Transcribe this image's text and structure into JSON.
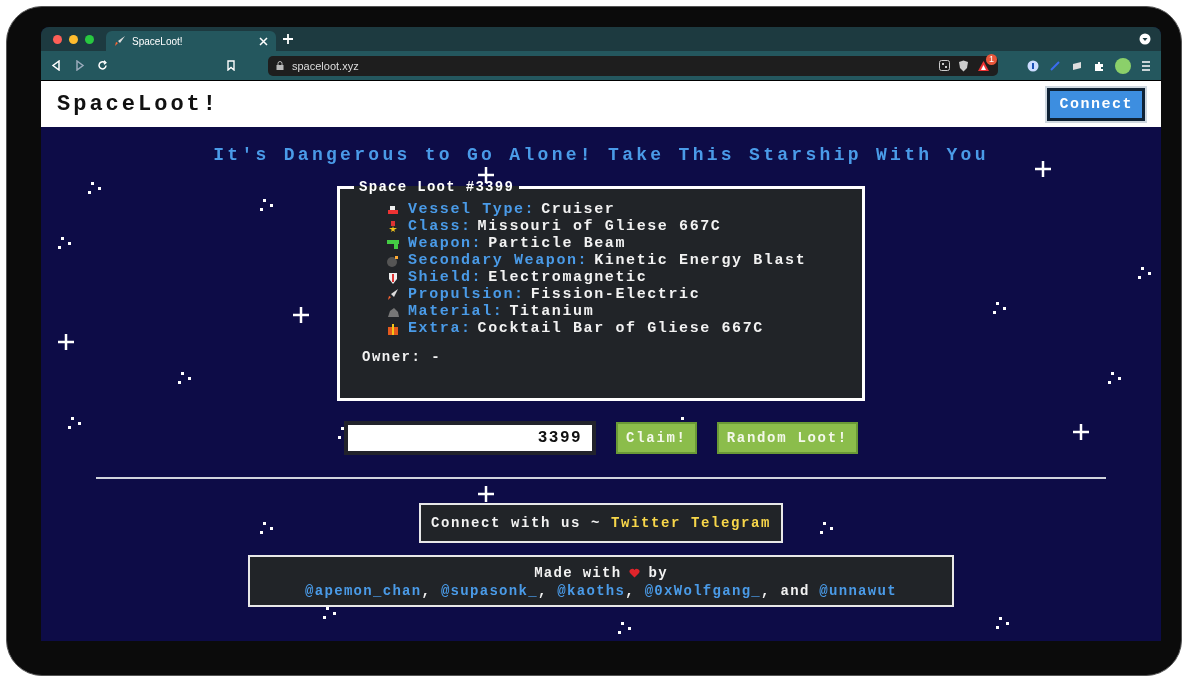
{
  "browser": {
    "tab_title": "SpaceLoot!",
    "url": "spaceloot.xyz",
    "alert_badge": "1"
  },
  "header": {
    "title": "SpaceLoot!",
    "connect_button": "Connect"
  },
  "headline": "It's Dangerous to Go Alone! Take This Starship With You",
  "loot_card": {
    "title": "Space Loot #3399",
    "traits": [
      {
        "kind": "ship",
        "label": "Vessel Type:",
        "value": "Cruiser"
      },
      {
        "kind": "medal",
        "label": "Class:",
        "value": "Missouri of Gliese 667C"
      },
      {
        "kind": "gun",
        "label": "Weapon:",
        "value": "Particle Beam"
      },
      {
        "kind": "bomb",
        "label": "Secondary Weapon:",
        "value": "Kinetic Energy Blast"
      },
      {
        "kind": "shield",
        "label": "Shield:",
        "value": "Electromagnetic"
      },
      {
        "kind": "rocket",
        "label": "Propulsion:",
        "value": "Fission-Electric"
      },
      {
        "kind": "rock",
        "label": "Material:",
        "value": "Titanium"
      },
      {
        "kind": "gift",
        "label": "Extra:",
        "value": "Cocktail Bar of Gliese 667C"
      }
    ],
    "owner": "Owner: -"
  },
  "claim_form": {
    "value": "3399",
    "claim_button": "Claim!",
    "random_button": "Random Loot!"
  },
  "social": {
    "text": "Connect with us ~",
    "links": [
      "Twitter",
      "Telegram"
    ]
  },
  "credits": {
    "made_with": "Made with",
    "by": "by",
    "parts": [
      {
        "kind": "link",
        "text": "@apemon_chan"
      },
      {
        "kind": "text",
        "text": ", "
      },
      {
        "kind": "link",
        "text": "@supasonk_"
      },
      {
        "kind": "text",
        "text": ", "
      },
      {
        "kind": "link",
        "text": "@kaoths"
      },
      {
        "kind": "text",
        "text": ", "
      },
      {
        "kind": "link",
        "text": "@0xWolfgang_"
      },
      {
        "kind": "text",
        "text": ", and "
      },
      {
        "kind": "link",
        "text": "@unnawut"
      }
    ]
  }
}
